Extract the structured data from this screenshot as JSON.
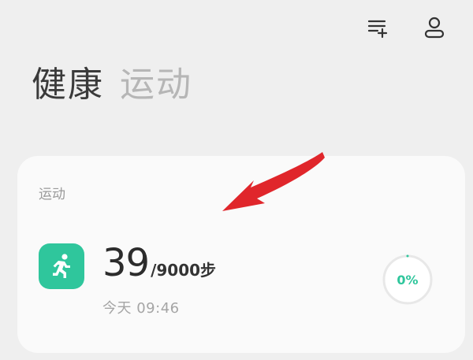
{
  "header": {
    "tabs": [
      {
        "label": "健康",
        "active": true
      },
      {
        "label": "运动",
        "active": false
      }
    ],
    "actions": {
      "add_list_icon": "list-add-icon",
      "profile_icon": "user-icon"
    }
  },
  "card": {
    "label": "运动",
    "app_icon": "running-icon",
    "steps_value": "39",
    "steps_goal": "/9000步",
    "timestamp": "今天 09:46",
    "progress_text": "0%",
    "progress_fraction": 0
  },
  "colors": {
    "accent": "#2fc69c",
    "annotation": "#e0262b"
  }
}
